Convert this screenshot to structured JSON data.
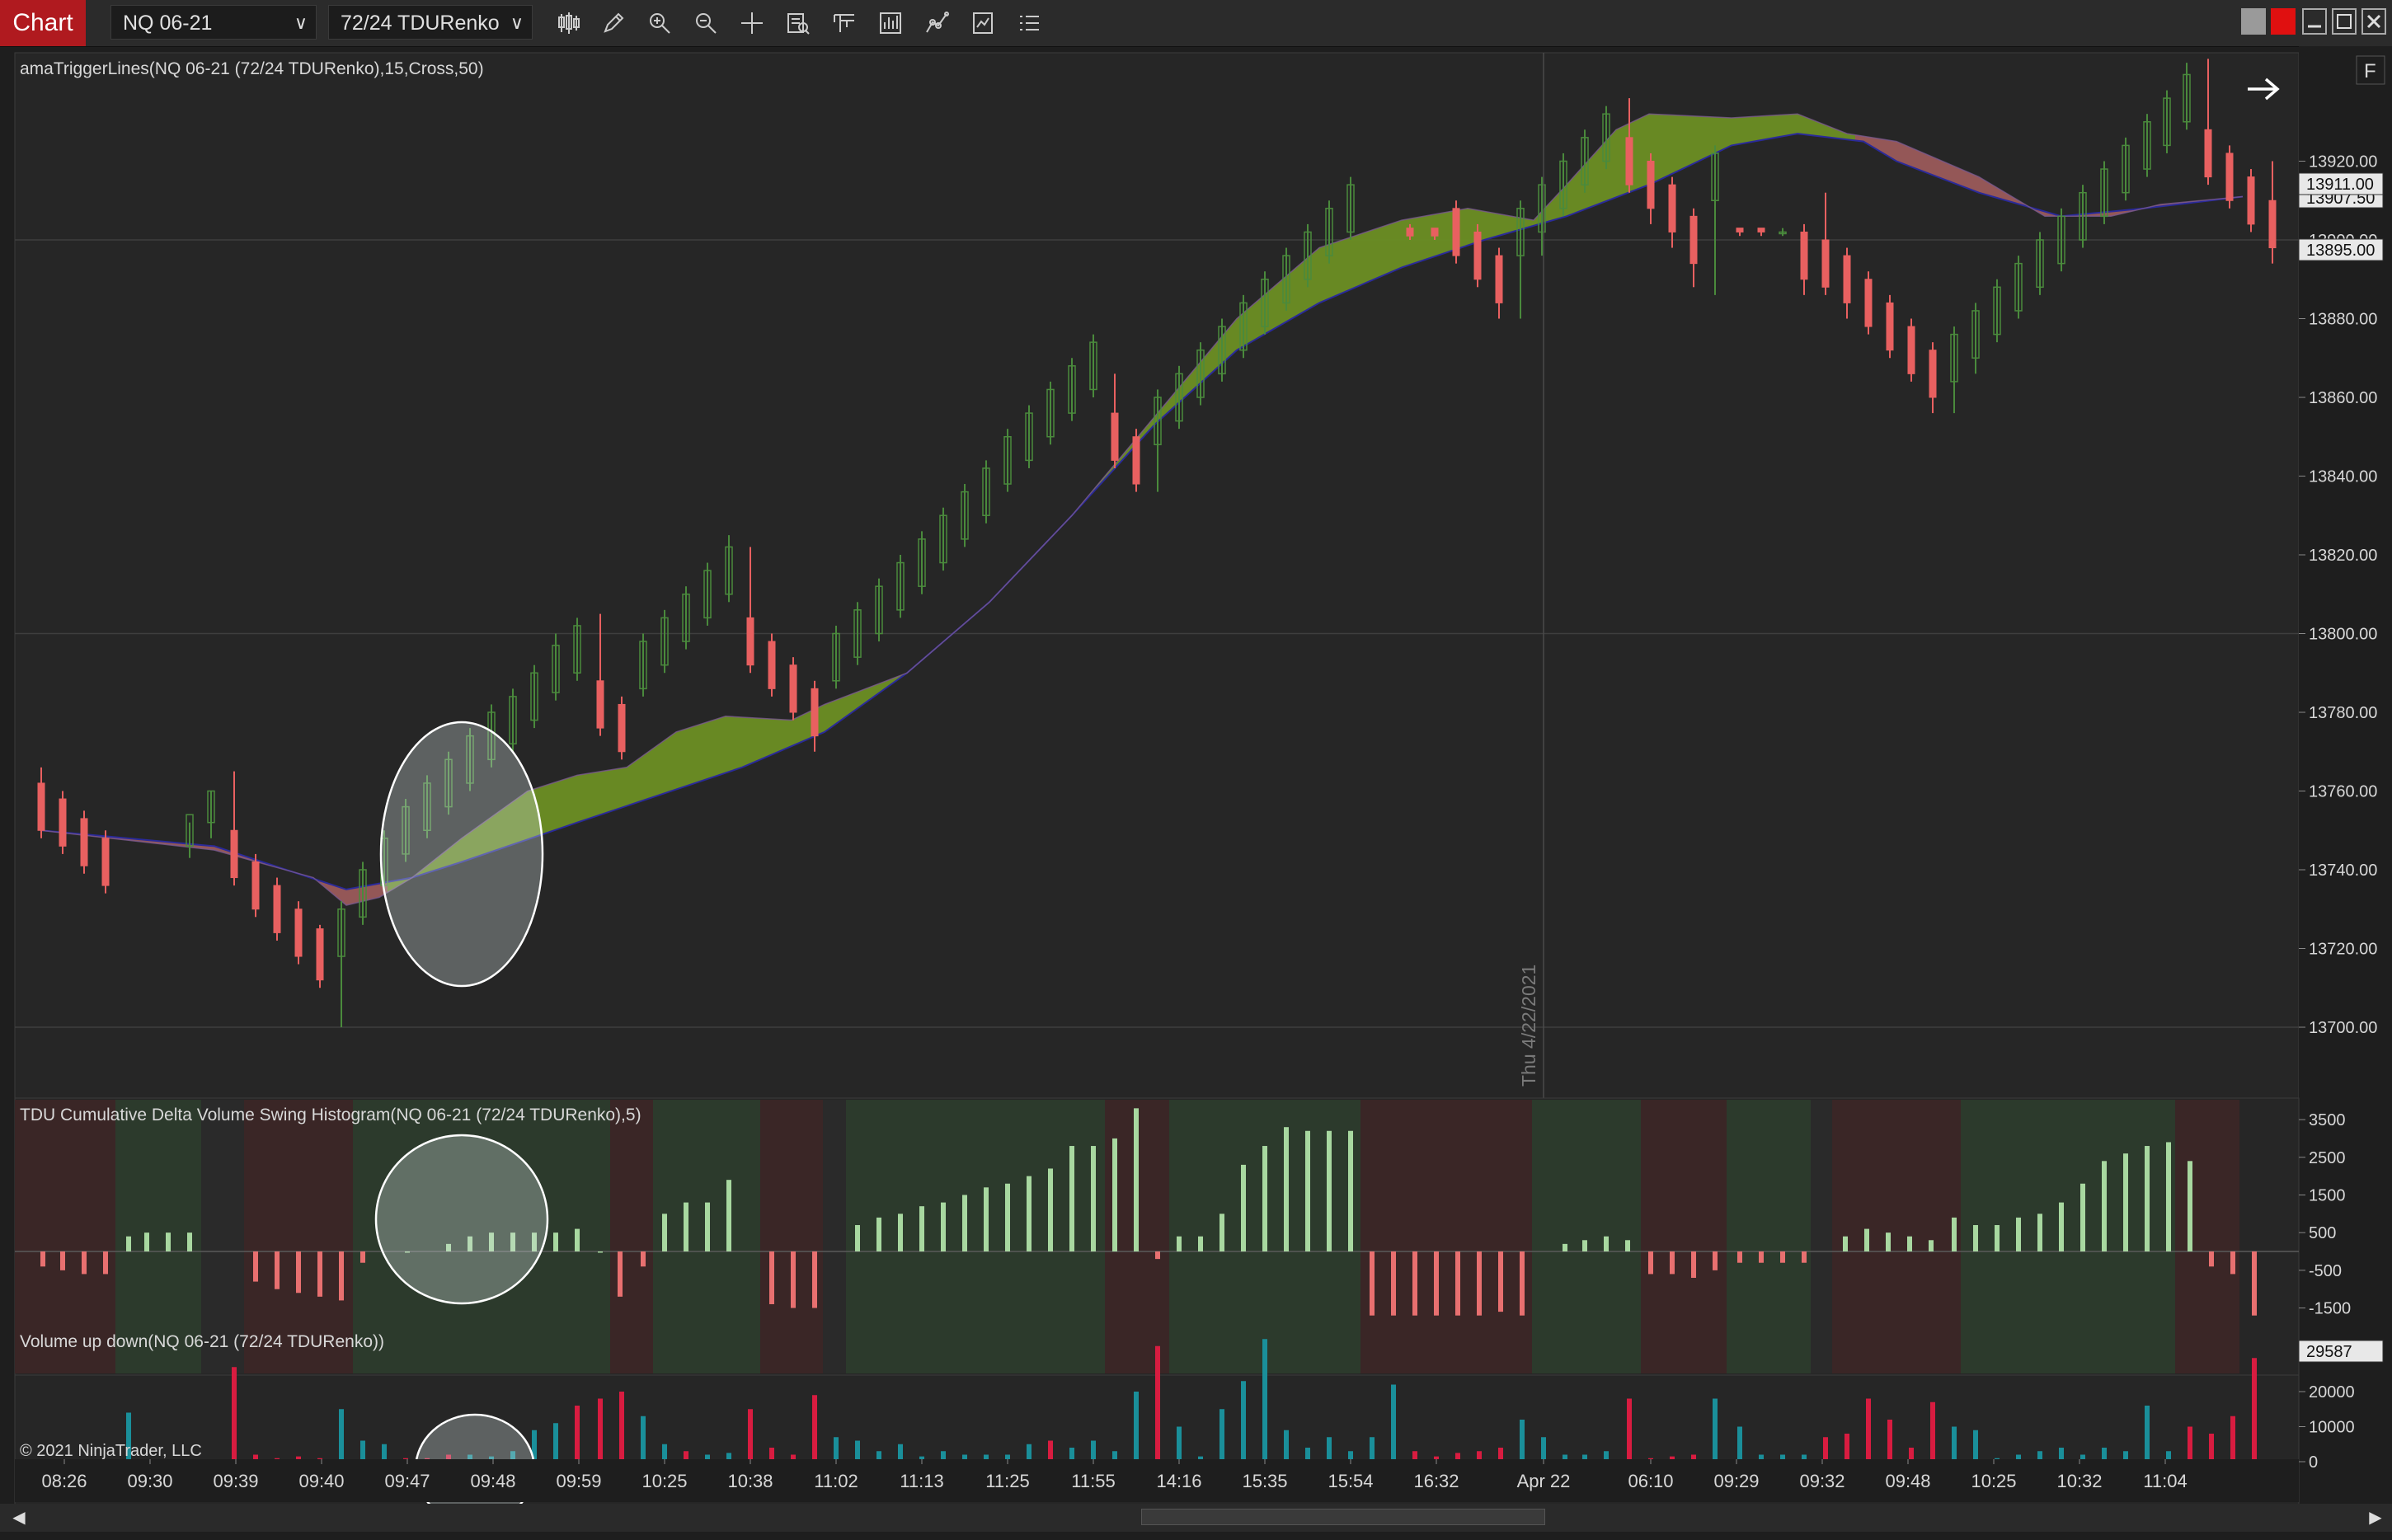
{
  "toolbar": {
    "title": "Chart",
    "instrument": "NQ 06-21",
    "bar_type": "72/24 TDURenko"
  },
  "panel1": {
    "title": "amaTriggerLines(NQ 06-21 (72/24 TDURenko),15,Cross,50)",
    "y_ticks": [
      "13920.00",
      "13900.00",
      "13880.00",
      "13860.00",
      "13840.00",
      "13820.00",
      "13800.00",
      "13780.00",
      "13760.00",
      "13740.00",
      "13720.00",
      "13700.00"
    ],
    "price_tags": [
      "13911.00",
      "13907.50",
      "13895.00"
    ],
    "date_marker": "Thu 4/22/2021",
    "f_button": "F"
  },
  "panel2": {
    "title": "TDU Cumulative Delta Volume Swing Histogram(NQ 06-21 (72/24 TDURenko),5)",
    "y_ticks": [
      "3500",
      "2500",
      "1500",
      "500",
      "-500",
      "-1500"
    ]
  },
  "panel3": {
    "title": "Volume up down(NQ 06-21 (72/24 TDURenko))",
    "y_ticks": [
      "20000",
      "10000",
      "0"
    ],
    "last_value": "29587",
    "copyright": "© 2021 NinjaTrader, LLC"
  },
  "x_axis": {
    "labels": [
      "08:26",
      "09:30",
      "09:39",
      "09:40",
      "09:47",
      "09:48",
      "09:59",
      "10:25",
      "10:38",
      "11:02",
      "11:13",
      "11:25",
      "11:55",
      "14:16",
      "15:35",
      "15:54",
      "16:32",
      "Apr 22",
      "06:10",
      "09:29",
      "09:32",
      "09:48",
      "10:25",
      "10:32",
      "11:04"
    ]
  },
  "colors": {
    "up": "#4a8a3c",
    "down": "#e86060",
    "delta_up": "#a8d8a0",
    "delta_down": "#e87070",
    "vol_up": "#1a8f9a",
    "vol_down": "#d81c40",
    "ribbon_bull": "#6b8e23",
    "ribbon_bear": "#9a5a5a",
    "line": "#2a2a9a"
  }
}
